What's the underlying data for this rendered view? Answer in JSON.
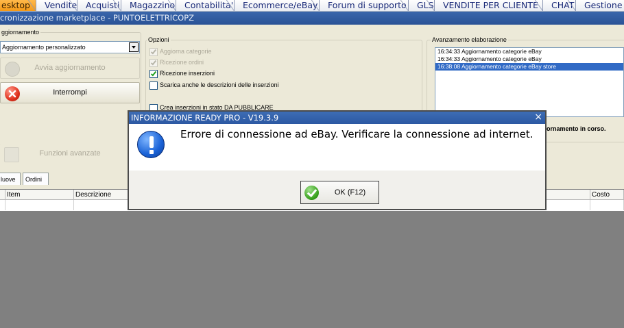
{
  "tabs": [
    {
      "label": "esktop",
      "active": true
    },
    {
      "label": "Vendite"
    },
    {
      "label": "Acquisti"
    },
    {
      "label": "Magazzino"
    },
    {
      "label": "Contabilita'"
    },
    {
      "label": "Ecommerce/eBay"
    },
    {
      "label": "Forum di supporto"
    },
    {
      "label": "GLS"
    },
    {
      "label": "VENDITE PER CLIENTE"
    },
    {
      "label": "CHAT"
    },
    {
      "label": "Gestione r"
    }
  ],
  "window": {
    "title": "cronizzazione marketplace - PUNTOELETTRICOPZ"
  },
  "aggiornamento": {
    "legend": "ggiornamento",
    "select_value": "Aggiornamento personalizzato",
    "avvia_label": "Avvia aggiornamento",
    "interrompi_label": "Interrompi",
    "funzioni_label": "Funzioni avanzate"
  },
  "opzioni": {
    "legend": "Opzioni",
    "items": [
      {
        "label": "Aggiorna categorie",
        "checked": true,
        "disabled": true
      },
      {
        "label": "Ricezione ordini",
        "checked": true,
        "disabled": true
      },
      {
        "label": "Ricezione inserzioni",
        "checked": true,
        "disabled": false
      },
      {
        "label": "Scarica anche le descrizioni delle inserzioni",
        "checked": false,
        "disabled": false
      },
      {
        "label": "Crea inserzioni in stato DA PUBBLICARE",
        "checked": false,
        "disabled": false
      }
    ]
  },
  "avanzamento": {
    "legend": "Avanzamento elaborazione",
    "lines": [
      {
        "text": "16:34:33 Aggiornamento categorie eBay",
        "selected": false
      },
      {
        "text": "16:34:33 Aggiornamento categorie eBay",
        "selected": false
      },
      {
        "text": "16:38:08 Aggiornamento categorie eBay store",
        "selected": true
      }
    ],
    "status": "ornamento in corso."
  },
  "subtabs": [
    {
      "label": "luove"
    },
    {
      "label": "Ordini"
    }
  ],
  "grid": {
    "columns": [
      "Item",
      "Descrizione",
      "Costo"
    ]
  },
  "dialog": {
    "title": "INFORMAZIONE READY PRO - V19.3.9",
    "close": "×",
    "message": "Errore di connessione ad eBay. Verificare la connessione ad internet.",
    "ok_label": "OK (F12)"
  },
  "colors": {
    "accent": "#f59a18",
    "titlebar": "#2a5296",
    "selection": "#316ac5"
  }
}
